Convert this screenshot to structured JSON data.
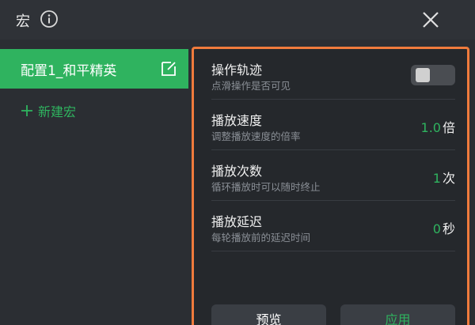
{
  "header": {
    "title": "宏",
    "info_icon": "info-circle-icon",
    "close_icon": "close-icon"
  },
  "sidebar": {
    "config_label": "配置1_和平精英",
    "edit_icon": "edit-icon",
    "new_macro_label": "新建宏"
  },
  "settings": {
    "trajectory": {
      "title": "操作轨迹",
      "subtitle": "点滑操作是否可见",
      "enabled": false
    },
    "speed": {
      "title": "播放速度",
      "subtitle": "调整播放速度的倍率",
      "value": "1.0",
      "unit": "倍"
    },
    "count": {
      "title": "播放次数",
      "subtitle": "循环播放时可以随时终止",
      "value": "1",
      "unit": "次"
    },
    "delay": {
      "title": "播放延迟",
      "subtitle": "每轮播放前的延迟时间",
      "value": "0",
      "unit": "秒"
    }
  },
  "buttons": {
    "preview": "预览",
    "apply": "应用"
  },
  "colors": {
    "accent": "#2fb35f",
    "highlight_border": "#f07b3c"
  }
}
